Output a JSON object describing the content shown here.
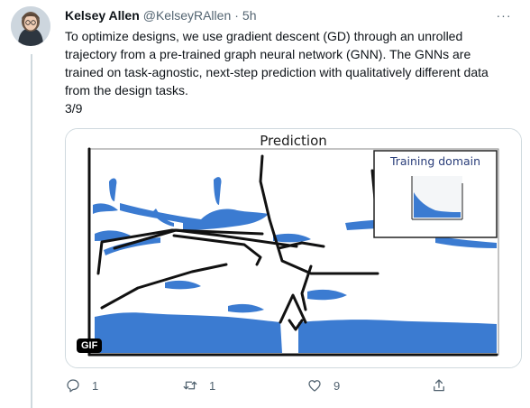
{
  "tweet": {
    "author_name": "Kelsey Allen",
    "handle": "@KelseyRAllen",
    "separator": "·",
    "time": "5h",
    "more_label": "···",
    "text": "To optimize designs, we use gradient descent (GD) through an unrolled trajectory from a pre-trained graph neural network (GNN). The GNNs are trained on task-agnostic, next-step prediction with qualitatively different data from the design tasks.\n3/9"
  },
  "media": {
    "title": "Prediction",
    "inset_title": "Training domain",
    "badge": "GIF",
    "fluid_color": "#3b7bd1",
    "wall_color": "#111111"
  },
  "actions": {
    "reply_count": "1",
    "retweet_count": "1",
    "like_count": "9",
    "share_label": ""
  },
  "colors": {
    "text_primary": "#0f1419",
    "text_secondary": "#536471",
    "border": "#cfd9de"
  }
}
